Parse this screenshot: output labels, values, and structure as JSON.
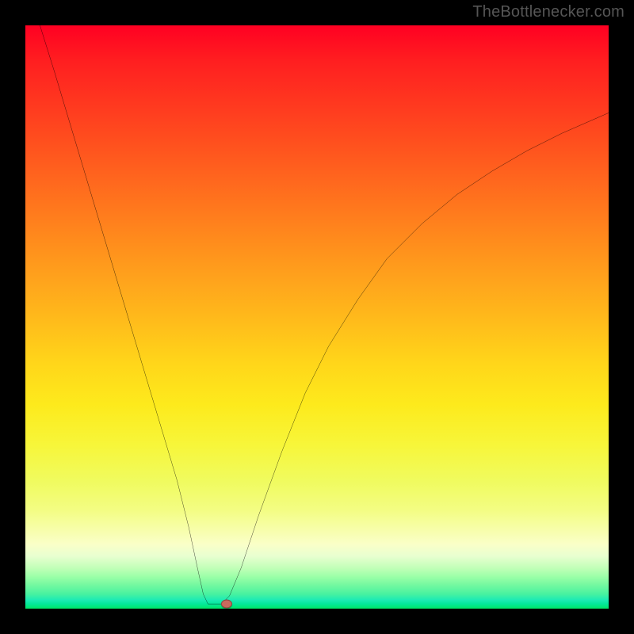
{
  "watermark": {
    "text": "TheBottlenecker.com"
  },
  "chart_data": {
    "type": "line",
    "title": "",
    "xlabel": "",
    "ylabel": "",
    "xlim": [
      0,
      100
    ],
    "ylim": [
      0,
      100
    ],
    "grid": false,
    "curve": [
      {
        "x": 2.5,
        "y": 100
      },
      {
        "x": 5,
        "y": 92
      },
      {
        "x": 8,
        "y": 82
      },
      {
        "x": 11,
        "y": 72
      },
      {
        "x": 14,
        "y": 62
      },
      {
        "x": 17,
        "y": 52
      },
      {
        "x": 20,
        "y": 42
      },
      {
        "x": 23,
        "y": 32
      },
      {
        "x": 26,
        "y": 22
      },
      {
        "x": 28,
        "y": 14
      },
      {
        "x": 29.5,
        "y": 7
      },
      {
        "x": 30.5,
        "y": 2.5
      },
      {
        "x": 31.3,
        "y": 0.8
      },
      {
        "x": 33.6,
        "y": 0.8
      },
      {
        "x": 35,
        "y": 2.2
      },
      {
        "x": 37,
        "y": 7
      },
      {
        "x": 40,
        "y": 16
      },
      {
        "x": 44,
        "y": 27
      },
      {
        "x": 48,
        "y": 37
      },
      {
        "x": 52,
        "y": 45
      },
      {
        "x": 57,
        "y": 53
      },
      {
        "x": 62,
        "y": 60
      },
      {
        "x": 68,
        "y": 66
      },
      {
        "x": 74,
        "y": 71
      },
      {
        "x": 80,
        "y": 75
      },
      {
        "x": 86,
        "y": 78.5
      },
      {
        "x": 92,
        "y": 81.5
      },
      {
        "x": 100,
        "y": 85
      }
    ],
    "marker": {
      "x": 34.5,
      "y": 0.8
    },
    "background_gradient": {
      "top": "#ff0022",
      "mid": "#ffd61a",
      "bottom": "#00e766"
    }
  }
}
